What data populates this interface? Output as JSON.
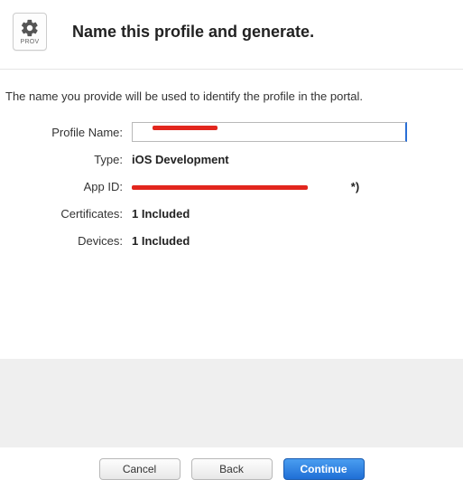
{
  "header": {
    "icon_caption": "PROV",
    "title": "Name this profile and generate."
  },
  "description": "The name you provide will be used to identify the profile in the portal.",
  "form": {
    "profile_name_label": "Profile Name:",
    "profile_name_value": "",
    "type_label": "Type:",
    "type_value": "iOS Development",
    "app_id_label": "App ID:",
    "app_id_value_suffix": "*)",
    "certificates_label": "Certificates:",
    "certificates_value": "1 Included",
    "devices_label": "Devices:",
    "devices_value": "1 Included"
  },
  "buttons": {
    "cancel": "Cancel",
    "back": "Back",
    "continue": "Continue"
  }
}
